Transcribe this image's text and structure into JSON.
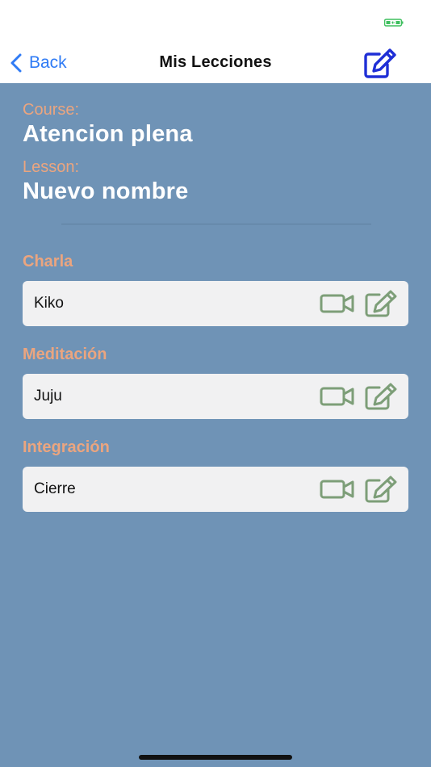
{
  "nav": {
    "back_label": "Back",
    "title": "Mis Lecciones"
  },
  "details": {
    "course_label": "Course:",
    "course_value": "Atencion plena",
    "lesson_label": "Lesson:",
    "lesson_value": "Nuevo nombre"
  },
  "sections": [
    {
      "title": "Charla",
      "item": "Kiko"
    },
    {
      "title": "Meditación",
      "item": "Juju"
    },
    {
      "title": "Integración",
      "item": "Cierre"
    }
  ],
  "colors": {
    "background": "#6f93b6",
    "accent_orange": "#eba57f",
    "icon_green": "#7d9e78",
    "nav_blue": "#2f7bf5",
    "edit_blue": "#1f2fd6"
  },
  "icons": {
    "back": "chevron-left-icon",
    "nav_edit": "edit-icon",
    "video": "video-camera-icon",
    "row_edit": "edit-icon",
    "battery": "battery-icon"
  }
}
